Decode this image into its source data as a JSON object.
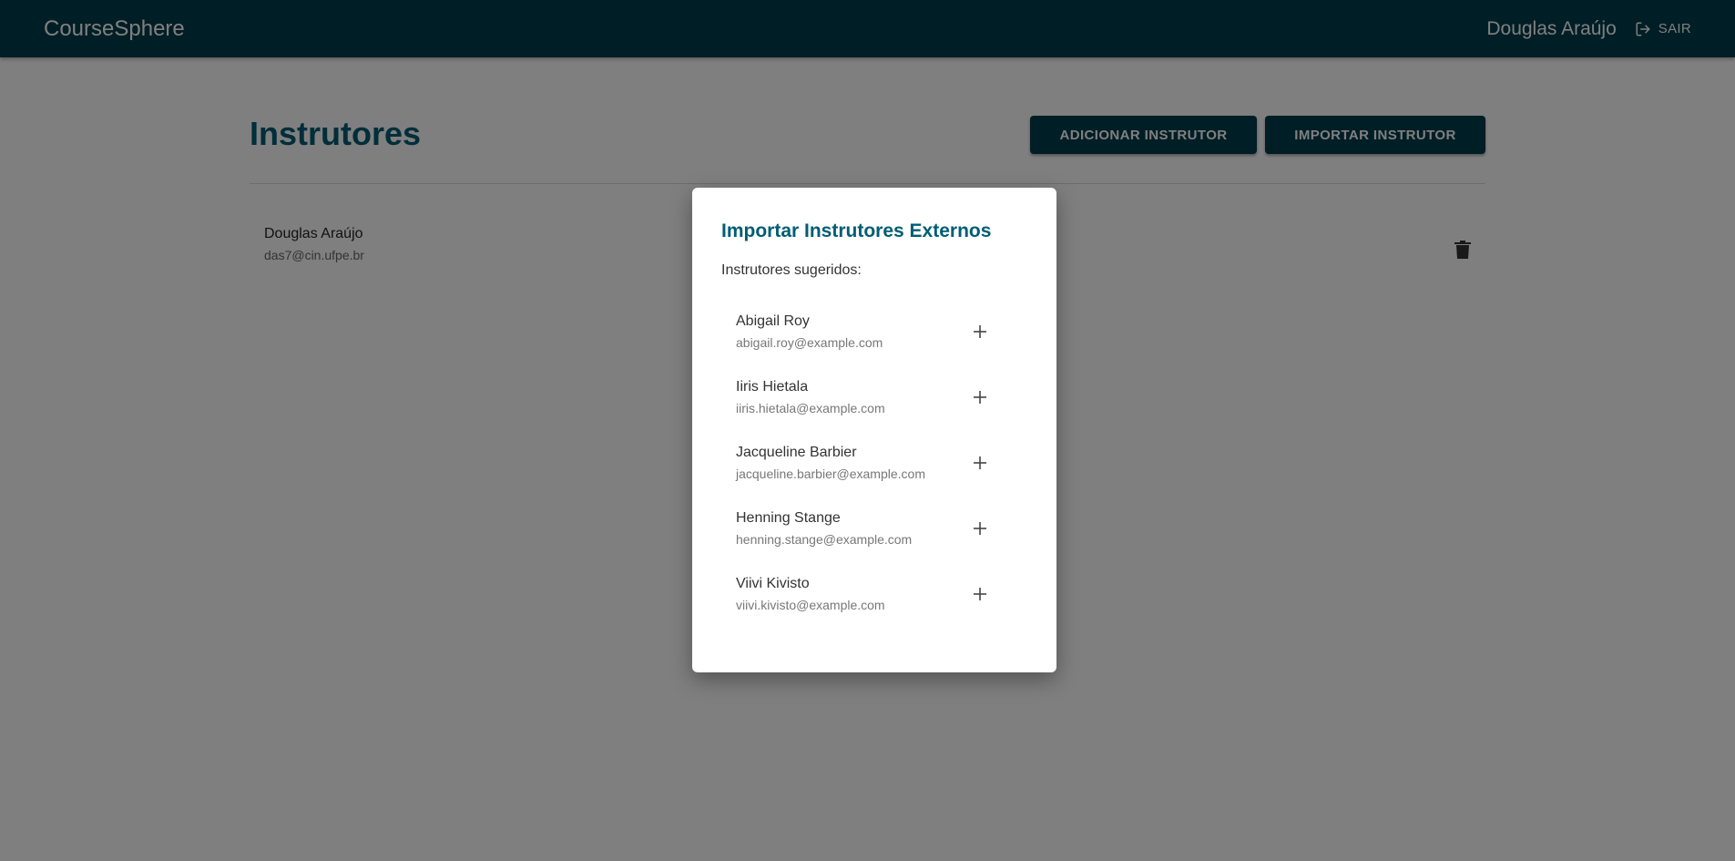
{
  "header": {
    "brand": "CourseSphere",
    "user_name": "Douglas Araújo",
    "logout_label": "SAIR",
    "logout_icon": "logout-icon"
  },
  "main": {
    "page_title": "Instrutores",
    "add_button_label": "ADICIONAR INSTRUTOR",
    "import_button_label": "IMPORTAR INSTRUTOR",
    "instructors": [
      {
        "name": "Douglas Araújo",
        "email": "das7@cin.ufpe.br",
        "delete_icon": "trash-icon"
      }
    ]
  },
  "modal": {
    "title": "Importar Instrutores Externos",
    "subtitle": "Instrutores sugeridos:",
    "add_icon": "plus-icon",
    "suggestions": [
      {
        "name": "Abigail Roy",
        "email": "abigail.roy@example.com"
      },
      {
        "name": "Iiris Hietala",
        "email": "iiris.hietala@example.com"
      },
      {
        "name": "Jacqueline Barbier",
        "email": "jacqueline.barbier@example.com"
      },
      {
        "name": "Henning Stange",
        "email": "henning.stange@example.com"
      },
      {
        "name": "Viivi Kivisto",
        "email": "viivi.kivisto@example.com"
      }
    ]
  },
  "colors": {
    "header_bg": "#003c4b",
    "accent": "#005d74",
    "overlay": "rgba(0,0,0,0.5)"
  }
}
